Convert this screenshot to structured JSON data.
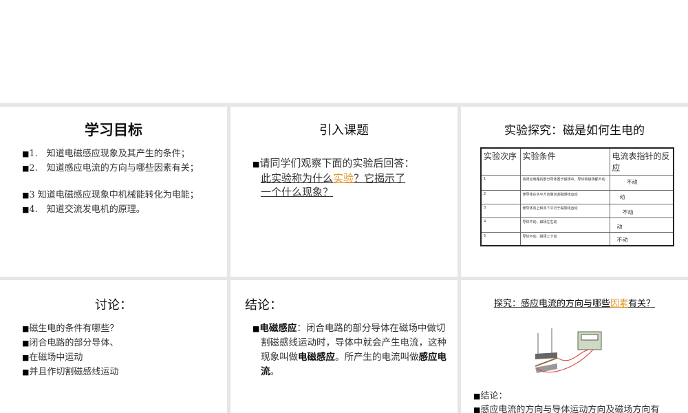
{
  "slides": {
    "goals": {
      "title": "学习目标",
      "items": [
        "1.　知道电磁感应现象及其产生的条件；",
        "2.　知道感应电流的方向与哪些因素有关；",
        "3 知道电磁感应现象中机械能转化为电能；",
        "4.　知道交流发电机的原理。"
      ]
    },
    "intro": {
      "title": "引入课题",
      "line1": "请同学们观察下面的实验后回答：",
      "line2a": "此实验称为什么",
      "link": "实验",
      "line2b": "？它揭示了",
      "line3": "一个什么现象？"
    },
    "experiment": {
      "title": "实验探究：磁是如何生电的",
      "headers": [
        "实验次序",
        "实验条件",
        "电流表指针的反应"
      ],
      "rows": [
        [
          "1",
          "将闭合电路的部分导体置于磁场中，导体和磁场都不动",
          "不动"
        ],
        [
          "2",
          "使导体在水平方向做切割磁感线运动",
          "动"
        ],
        [
          "3",
          "使导体向上和向下平行于磁感线运动",
          "不动"
        ],
        [
          "4",
          "导体不动，磁场左右动",
          "动"
        ],
        [
          "5",
          "导体不动，磁场上下动",
          "不动"
        ]
      ]
    },
    "discussion": {
      "title": "讨论：",
      "items": [
        "磁生电的条件有哪些？",
        "闭合电路的部分导体、",
        "在磁场中运动",
        "并且作切割磁感线运动"
      ]
    },
    "conclusion": {
      "title": "结论：",
      "term1": "电磁感应",
      "t1": "：闭合电路的部分导体在磁场中做切割磁感线运动时，导体中就会产生电流，这种现象叫做",
      "term2": "电磁感应",
      "t2": "。所产生的电流叫做",
      "term3": "感应电流",
      "t3": "。"
    },
    "explore": {
      "title_a": "探究：感应电流的方向与哪些",
      "title_link": "因素",
      "title_b": "有关？",
      "items": [
        "结论：",
        "感应电流的方向与导体运动方向及磁场方向有"
      ]
    }
  },
  "colors": {
    "link": "#e0962a",
    "bg": "#e6e6e6"
  }
}
